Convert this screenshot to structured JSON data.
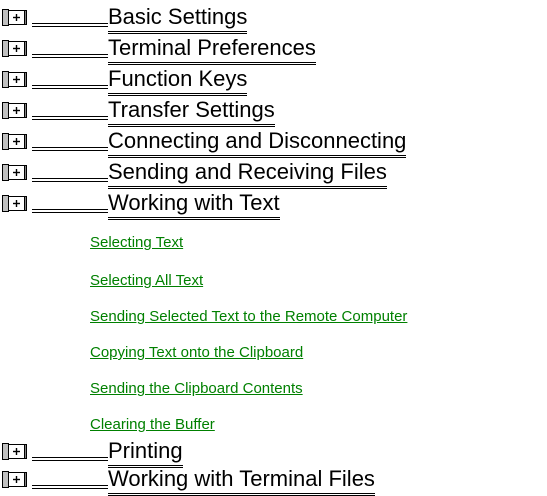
{
  "books": [
    {
      "title": "Basic Settings",
      "icon": "closed-book-plus-icon"
    },
    {
      "title": "Terminal Preferences",
      "icon": "closed-book-plus-icon"
    },
    {
      "title": "Function Keys",
      "icon": "closed-book-plus-icon"
    },
    {
      "title": "Transfer Settings",
      "icon": "closed-book-plus-icon"
    },
    {
      "title": "Connecting and Disconnecting",
      "icon": "closed-book-plus-icon"
    },
    {
      "title": "Sending and Receiving Files",
      "icon": "closed-book-plus-icon"
    },
    {
      "title": "Working with Text",
      "icon": "closed-book-plus-icon"
    },
    {
      "title": "Printing",
      "icon": "closed-book-plus-icon"
    },
    {
      "title": "Working with Terminal Files",
      "icon": "closed-book-plus-icon"
    }
  ],
  "topics": [
    "Selecting Text",
    "Selecting All Text",
    "Sending Selected Text to the Remote Computer",
    "Copying Text onto the Clipboard",
    "Sending the Clipboard Contents",
    "Clearing the Buffer"
  ],
  "colors": {
    "topic_link": "#008000",
    "book_title": "#000000",
    "background": "#ffffff"
  }
}
